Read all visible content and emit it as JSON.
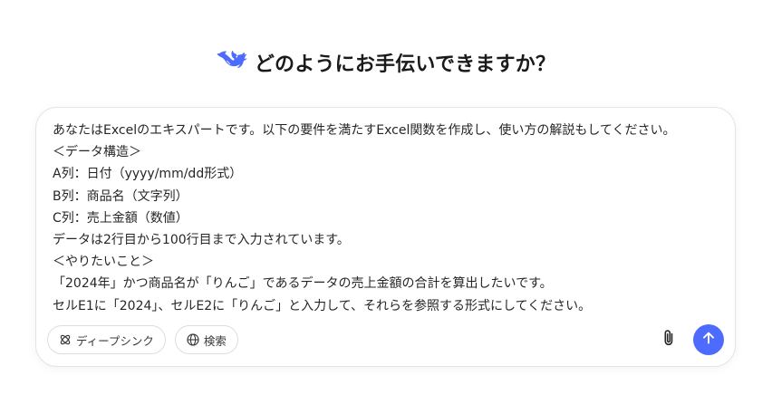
{
  "header": {
    "greeting": "どのようにお手伝いできますか？",
    "logo_icon": "deepseek-whale-icon",
    "logo_color": "#4d6bfe"
  },
  "composer": {
    "lines": [
      "あなたはExcelのエキスパートです。以下の要件を満たすExcel関数を作成し、使い方の解説もしてください。",
      "＜データ構造＞",
      "A列：日付（yyyy/mm/dd形式）",
      "B列：商品名（文字列）",
      "C列：売上金額（数値）",
      "データは2行目から100行目まで入力されています。",
      "＜やりたいこと＞",
      "「2024年」かつ商品名が「りんご」であるデータの売上金額の合計を算出したいです。",
      "セルE1に「2024」、セルE2に「りんご」と入力して、それらを参照する形式にしてください。"
    ]
  },
  "toolbar": {
    "deepthink_label": "ディープシンク",
    "deepthink_icon": "atom-icon",
    "search_label": "検索",
    "search_icon": "globe-icon",
    "attach_icon": "paperclip-icon",
    "send_icon": "arrow-up-icon",
    "accent_color": "#4d6bfe"
  }
}
